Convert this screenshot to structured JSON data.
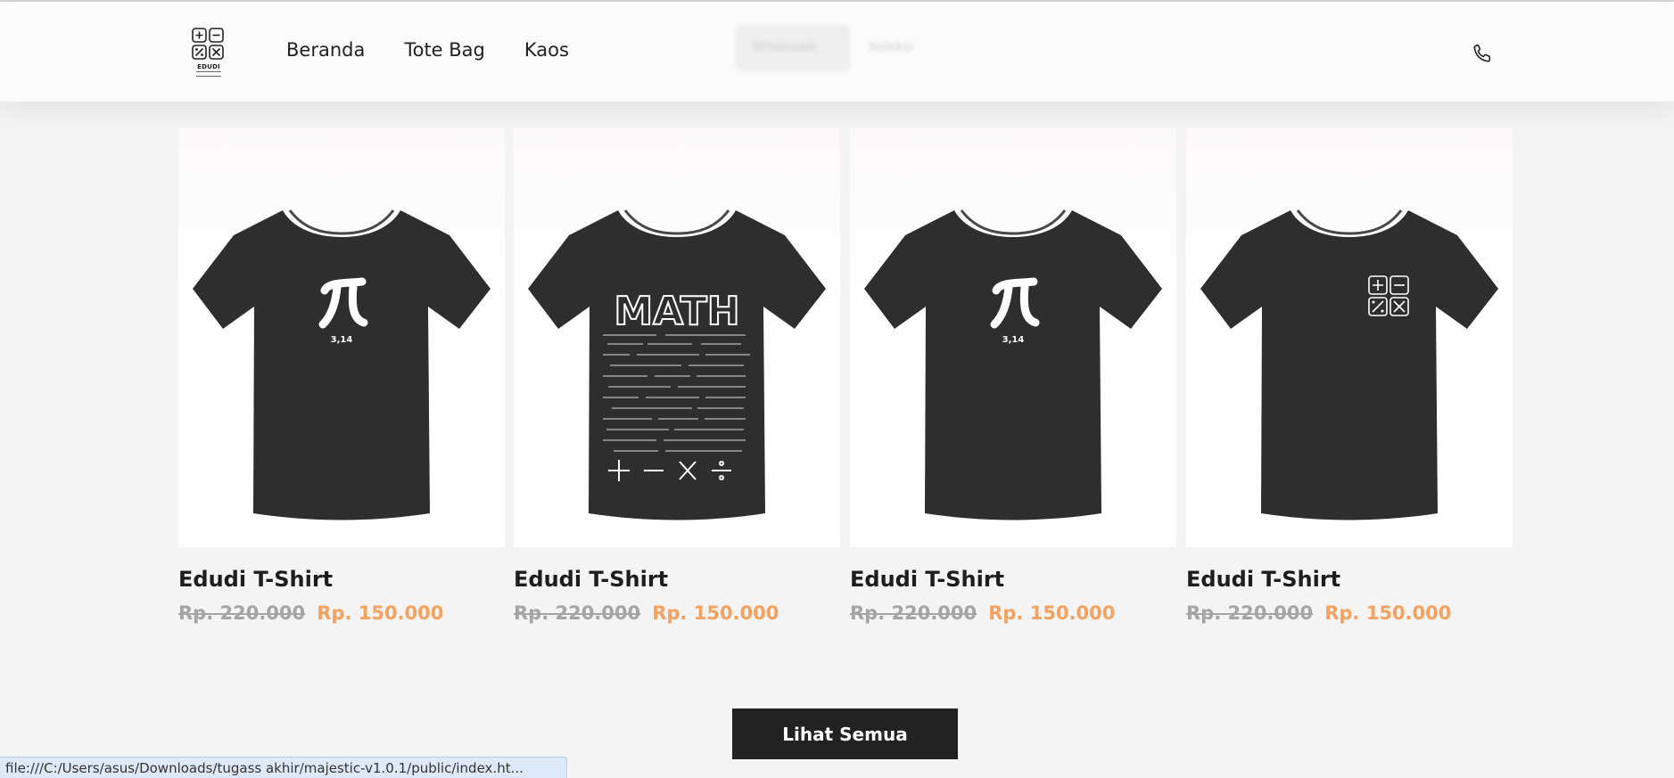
{
  "header": {
    "logo_text": "EDUDI",
    "nav": [
      "Beranda",
      "Tote Bag",
      "Kaos"
    ],
    "blurred_items": [
      "Wholesale",
      "Koleksi"
    ]
  },
  "products": [
    {
      "name": "Edudi T-Shirt",
      "old_price": "Rp. 220.000",
      "new_price": "Rp. 150.000",
      "design": "pi-icon",
      "design_text": "3,14"
    },
    {
      "name": "Edudi T-Shirt",
      "old_price": "Rp. 220.000",
      "new_price": "Rp. 150.000",
      "design": "math-formula-print",
      "design_text": "MATH"
    },
    {
      "name": "Edudi T-Shirt",
      "old_price": "Rp. 220.000",
      "new_price": "Rp. 150.000",
      "design": "pi-icon",
      "design_text": "3,14"
    },
    {
      "name": "Edudi T-Shirt",
      "old_price": "Rp. 220.000",
      "new_price": "Rp. 150.000",
      "design": "calculator-logo-icon",
      "design_text": ""
    }
  ],
  "cta": {
    "label": "Lihat Semua"
  },
  "status_url": "file:///C:/Users/asus/Downloads/tugass akhir/majestic-v1.0.1/public/index.ht...",
  "colors": {
    "accent": "#f5a15f",
    "old_price": "#a5a5a5",
    "button_bg": "#222222",
    "shirt": "#2e2e2e"
  }
}
